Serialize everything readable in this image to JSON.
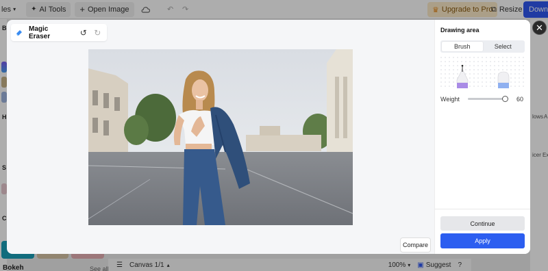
{
  "toolbar": {
    "file_label": "les",
    "ai_tools_label": "AI Tools",
    "open_image_label": "Open Image",
    "upgrade_label": "Upgrade to Pro",
    "resize_label": "Resize",
    "download_label": "Downlo"
  },
  "left_panel": {
    "letters": [
      "B",
      "H",
      "S",
      "C"
    ],
    "bokeh_label": "Bokeh",
    "see_all_label": "See all"
  },
  "right_panel": {
    "labels": [
      "lows",
      "A",
      "icer",
      "Ext"
    ]
  },
  "bottom_bar": {
    "canvas_label": "Canvas 1/1",
    "zoom_label": "100%",
    "suggest_label": "Suggest",
    "help_label": "?"
  },
  "modal": {
    "title": "Magic Eraser",
    "compare_label": "Compare",
    "panel": {
      "heading": "Drawing area",
      "modes": [
        "Brush",
        "Select"
      ],
      "active_mode": "Brush",
      "weight_label": "Weight",
      "weight_value": "60",
      "continue_label": "Continue",
      "apply_label": "Apply"
    }
  },
  "colors": {
    "accent": "#2c5ef0",
    "brush_purple": "#a98be6",
    "eraser_blue": "#8fb0f0",
    "upgrade_bg": "#fdebc9"
  },
  "icons": [
    "chevron-down-icon",
    "ai-tools-icon",
    "plus-icon",
    "cloud-icon",
    "undo-icon",
    "redo-icon",
    "crown-icon",
    "resize-icon",
    "magic-eraser-icon",
    "close-icon",
    "layers-icon",
    "suggest-icon"
  ]
}
